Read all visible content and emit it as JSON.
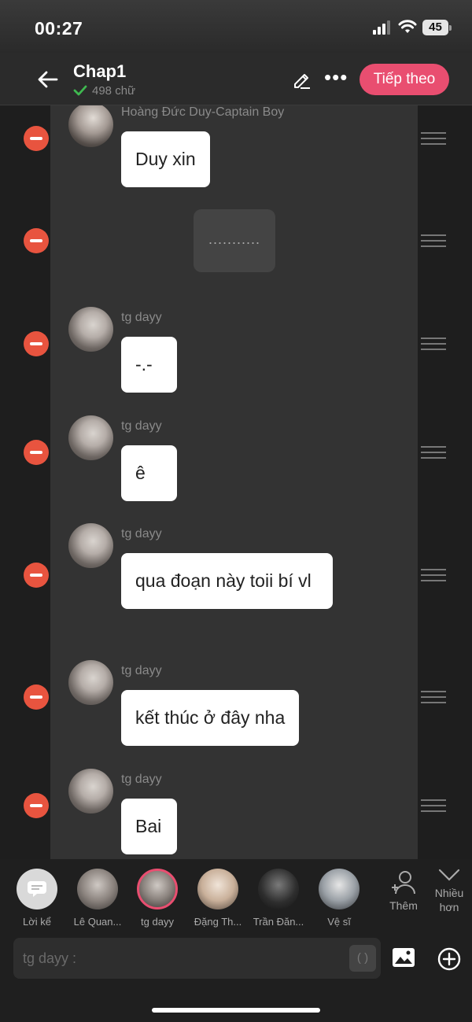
{
  "status_bar": {
    "time": "00:27",
    "battery": "45"
  },
  "header": {
    "title": "Chap1",
    "word_count": "498 chữ",
    "next_label": "Tiếp theo",
    "more_label": "•••"
  },
  "messages": [
    {
      "author": "Hoàng Đức Duy-Captain Boy",
      "text": "Duy xin"
    },
    {
      "author": "",
      "text": "..........."
    },
    {
      "author": "tg dayy",
      "text": "-.-"
    },
    {
      "author": "tg dayy",
      "text": "ê"
    },
    {
      "author": "tg dayy",
      "text": "qua đoạn này toii bí vl"
    },
    {
      "author": "tg dayy",
      "text": "kết thúc ở đây nha"
    },
    {
      "author": "tg dayy",
      "text": "Bai"
    }
  ],
  "characters": [
    {
      "name": "Lời kể"
    },
    {
      "name": "Lê Quan..."
    },
    {
      "name": "tg dayy"
    },
    {
      "name": "Đặng Th..."
    },
    {
      "name": "Trần Đăn..."
    },
    {
      "name": "Vệ sĩ"
    }
  ],
  "add_character_label": "Thêm",
  "more_characters_label": "Nhiều hơn",
  "composer": {
    "placeholder": "tg dayy :",
    "bracket": "( )"
  },
  "colors": {
    "accent": "#e94e70",
    "delete": "#e8543f",
    "verified": "#3fb950"
  },
  "icons": [
    "back-arrow-icon",
    "check-icon",
    "pencil-icon",
    "more-icon",
    "minus-icon",
    "drag-handle-icon",
    "narrator-icon",
    "add-person-icon",
    "chevron-down-icon",
    "image-icon",
    "plus-circle-icon"
  ]
}
